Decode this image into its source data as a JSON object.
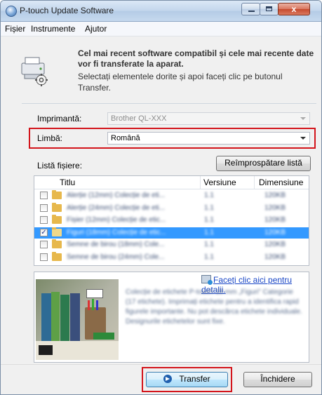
{
  "window": {
    "title": "P-touch Update Software",
    "close_label": "x"
  },
  "menu": [
    "Fișier",
    "Instrumente",
    "Ajutor"
  ],
  "header": {
    "bold_text": "Cel mai recent software compatibil și cele mai recente date vor fi transferate la aparat.",
    "text": "Selectați elementele dorite și apoi faceți clic pe butonul Transfer."
  },
  "printer": {
    "label": "Imprimantă:",
    "value": "Brother QL-XXX"
  },
  "language": {
    "label": "Limbă:",
    "value": "Română"
  },
  "file_list": {
    "label": "Listă fișiere:",
    "refresh_button": "Reîmprospătare listă",
    "columns": [
      "Titlu",
      "Versiune",
      "Dimensiune"
    ],
    "rows": [
      {
        "title": "Alerție (12mm) Colecție de eti...",
        "version": "1.1",
        "size": "120KB",
        "checked": false,
        "selected": false
      },
      {
        "title": "Alerție (24mm) Colecție de eti...",
        "version": "1.1",
        "size": "120KB",
        "checked": false,
        "selected": false
      },
      {
        "title": "Fișier (12mm) Colecție de etic...",
        "version": "1.1",
        "size": "120KB",
        "checked": false,
        "selected": false
      },
      {
        "title": "Figuri (18mm) Colecție de etic...",
        "version": "1.1",
        "size": "120KB",
        "checked": true,
        "selected": true
      },
      {
        "title": "Semne de birou (18mm) Cole...",
        "version": "1.1",
        "size": "120KB",
        "checked": false,
        "selected": false
      },
      {
        "title": "Semne de birou (24mm) Cole...",
        "version": "1.1",
        "size": "120KB",
        "checked": false,
        "selected": false
      }
    ]
  },
  "details": {
    "link": "Faceți clic aici pentru detalii.",
    "description": "Colecție de etichete P-touch 18 mm „Figuri” Categorie (17 etichete). Imprimați etichete pentru a identifica rapid figurele importante. Nu pot descărca etichete individuale. Designurile etichetelor sunt fixe."
  },
  "buttons": {
    "transfer": "Transfer",
    "close": "Închidere"
  },
  "colors": {
    "highlight": "#d3141b",
    "selection": "#3399ff",
    "link": "#1a47c6"
  }
}
